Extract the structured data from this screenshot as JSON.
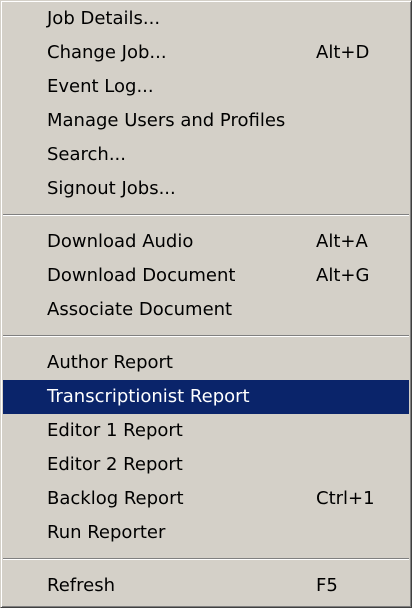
{
  "menu": {
    "group1": [
      {
        "label": "Job Details...",
        "shortcut": ""
      },
      {
        "label": "Change Job...",
        "shortcut": "Alt+D"
      },
      {
        "label": "Event Log...",
        "shortcut": ""
      },
      {
        "label": "Manage Users and Profiles",
        "shortcut": ""
      },
      {
        "label": "Search...",
        "shortcut": ""
      },
      {
        "label": "Signout Jobs...",
        "shortcut": ""
      }
    ],
    "group2": [
      {
        "label": "Download Audio",
        "shortcut": "Alt+A"
      },
      {
        "label": "Download Document",
        "shortcut": "Alt+G"
      },
      {
        "label": "Associate Document",
        "shortcut": ""
      }
    ],
    "group3": [
      {
        "label": "Author Report",
        "shortcut": ""
      },
      {
        "label": "Transcriptionist Report",
        "shortcut": "",
        "highlighted": true
      },
      {
        "label": "Editor 1 Report",
        "shortcut": ""
      },
      {
        "label": "Editor 2 Report",
        "shortcut": ""
      },
      {
        "label": "Backlog Report",
        "shortcut": "Ctrl+1"
      },
      {
        "label": "Run Reporter",
        "shortcut": ""
      }
    ],
    "group4": [
      {
        "label": "Refresh",
        "shortcut": "F5"
      }
    ]
  },
  "colors": {
    "menu_background": "#d4d0c8",
    "highlight_background": "#0a246a",
    "highlight_text": "#ffffff"
  }
}
